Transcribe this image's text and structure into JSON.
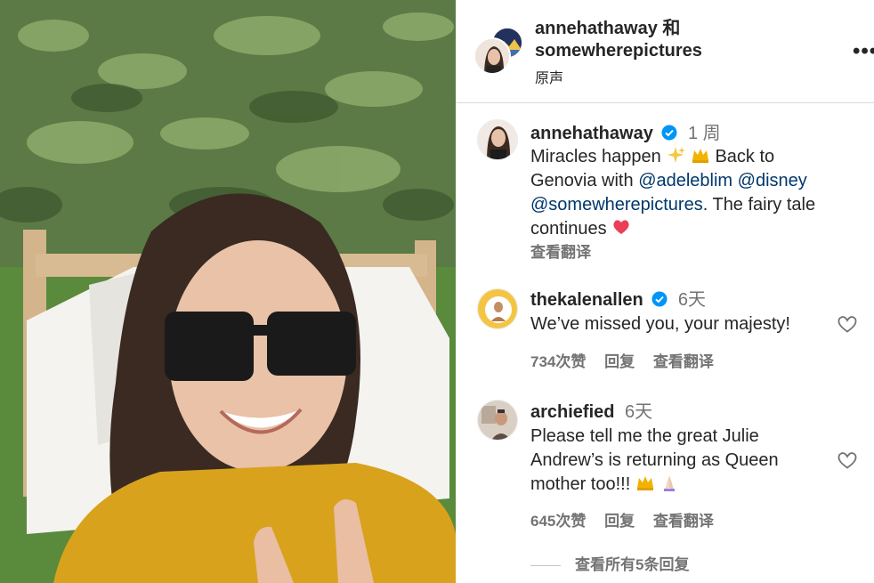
{
  "header": {
    "account1": "annehathaway",
    "joiner": "和",
    "account2": "somewherepictures",
    "audio": "原声",
    "more": "•••"
  },
  "caption": {
    "username": "annehathaway",
    "time": "1 周",
    "text_part1": "Miracles happen",
    "text_part2": "Back to Genovia with",
    "mention1": "@adeleblim",
    "mention2": "@disney",
    "mention3": "@somewherepictures",
    "text_part3": ". The fairy tale continues",
    "translate": "查看翻译"
  },
  "comments": [
    {
      "username": "thekalenallen",
      "time": "6天",
      "text": "We’ve missed you, your majesty!",
      "likes": "734次赞",
      "reply": "回复",
      "translate": "查看翻译"
    },
    {
      "username": "archiefied",
      "time": "6天",
      "text_line1": "Please tell me the great Julie",
      "text_line2": "Andrew’s is returning as Queen",
      "text_line3": "mother too!!!",
      "likes": "645次赞",
      "reply": "回复",
      "translate": "查看翻译"
    }
  ],
  "view_all_replies": "查看所有5条回复",
  "icons": {
    "verified": "verified-badge-icon",
    "heart": "heart-outline-icon",
    "more": "more-horizontal-icon"
  },
  "colors": {
    "verified": "#0095f6",
    "mention": "#00376b",
    "secondary_text": "#737373"
  }
}
